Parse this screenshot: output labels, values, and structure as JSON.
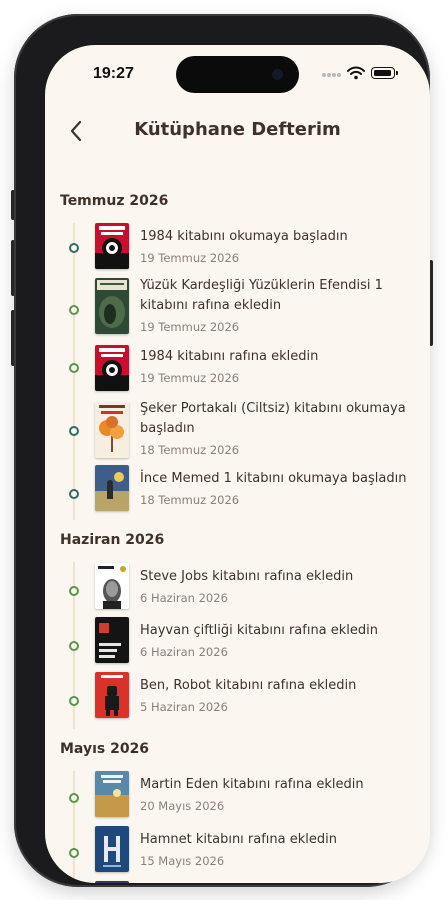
{
  "status_bar": {
    "time": "19:27"
  },
  "header": {
    "title": "Kütüphane Defterim",
    "back_icon": "chevron-left-icon"
  },
  "colors": {
    "background": "#fbf7f0",
    "text": "#3f3129",
    "date": "#8a7f77",
    "dot_teal": "#2f6b63",
    "dot_green": "#5b9447"
  },
  "sections": [
    {
      "title": "Temmuz 2026",
      "items": [
        {
          "text": "1984 kitabını okumaya başladın",
          "date": "19 Temmuz 2026",
          "dot": "teal",
          "cover": "1984"
        },
        {
          "text": "Yüzük Kardeşliği Yüzüklerin Efendisi 1 kitabını rafına ekledin",
          "date": "19 Temmuz 2026",
          "dot": "green",
          "cover": "Yüzük Kardeşliği"
        },
        {
          "text": "1984 kitabını rafına ekledin",
          "date": "19 Temmuz 2026",
          "dot": "green",
          "cover": "1984"
        },
        {
          "text": "Şeker Portakalı (Ciltsiz) kitabını okumaya başladın",
          "date": "18 Temmuz 2026",
          "dot": "teal",
          "cover": "Şeker Portakalı"
        },
        {
          "text": "İnce Memed 1 kitabını okumaya başladın",
          "date": "18 Temmuz 2026",
          "dot": "teal",
          "cover": "İnce Memed"
        }
      ]
    },
    {
      "title": "Haziran 2026",
      "items": [
        {
          "text": "Steve Jobs kitabını rafına ekledin",
          "date": "6 Haziran 2026",
          "dot": "green",
          "cover": "Steve Jobs"
        },
        {
          "text": "Hayvan çiftliği kitabını rafına ekledin",
          "date": "6 Haziran 2026",
          "dot": "green",
          "cover": "Hayvan Çiftliği"
        },
        {
          "text": "Ben, Robot kitabını rafına ekledin",
          "date": "5 Haziran 2026",
          "dot": "green",
          "cover": "Ben, Robot"
        }
      ]
    },
    {
      "title": "Mayıs 2026",
      "items": [
        {
          "text": "Martin Eden kitabını rafına ekledin",
          "date": "20 Mayıs 2026",
          "dot": "green",
          "cover": "Martin Eden"
        },
        {
          "text": "Hamnet kitabını rafına ekledin",
          "date": "15 Mayıs 2026",
          "dot": "green",
          "cover": "Hamnet"
        }
      ]
    }
  ]
}
